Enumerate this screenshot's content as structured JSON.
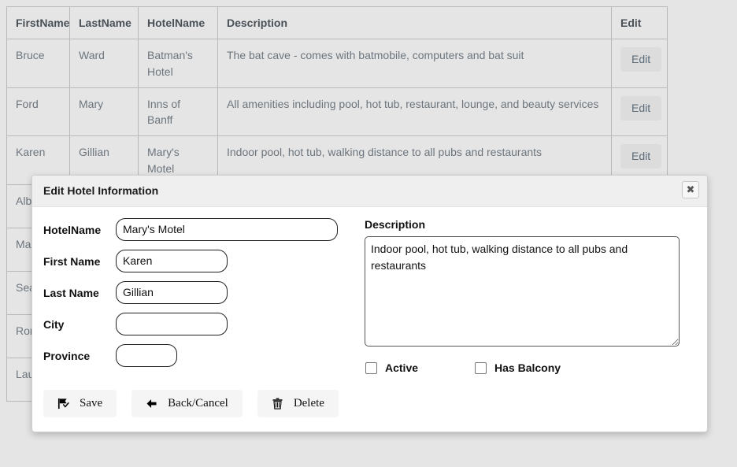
{
  "table": {
    "columns": [
      "FirstName",
      "LastName",
      "HotelName",
      "Description",
      "Edit"
    ],
    "edit_label": "Edit",
    "rows": [
      {
        "first": "Bruce",
        "last": "Ward",
        "hotel": "Batman's Hotel",
        "description": "The bat cave - comes with batmobile, computers and bat suit"
      },
      {
        "first": "Ford",
        "last": "Mary",
        "hotel": "Inns of Banff",
        "description": "All amenities including pool, hot tub, restaurant, lounge, and beauty services"
      },
      {
        "first": "Karen",
        "last": "Gillian",
        "hotel": "Mary's Motel",
        "description": "Indoor pool, hot tub, walking distance to all pubs and restaurants"
      },
      {
        "first": "Albert",
        "last": "",
        "hotel": "",
        "description": ""
      },
      {
        "first": "Max",
        "last": "",
        "hotel": "",
        "description": ""
      },
      {
        "first": "Sean",
        "last": "",
        "hotel": "",
        "description": ""
      },
      {
        "first": "Ron",
        "last": "",
        "hotel": "",
        "description": ""
      },
      {
        "first": "Laura",
        "last": "",
        "hotel": "",
        "description": ""
      }
    ]
  },
  "dialog": {
    "title": "Edit Hotel Information",
    "close_label": "✖",
    "fields": {
      "hotel_name": {
        "label": "HotelName",
        "value": "Mary's Motel",
        "placeholder": ""
      },
      "first_name": {
        "label": "First Name",
        "value": "Karen",
        "placeholder": ""
      },
      "last_name": {
        "label": "Last Name",
        "value": "Gillian",
        "placeholder": ""
      },
      "city": {
        "label": "City",
        "value": "",
        "placeholder": ""
      },
      "province": {
        "label": "Province",
        "value": "",
        "placeholder": ""
      }
    },
    "description": {
      "label": "Description",
      "value": "Indoor pool, hot tub, walking distance to all pubs and restaurants",
      "placeholder": ""
    },
    "checkboxes": [
      {
        "label": "Active",
        "checked": false
      },
      {
        "label": "Has Balcony",
        "checked": false
      }
    ],
    "buttons": [
      {
        "label": "Save",
        "icon": "save-flag-icon"
      },
      {
        "label": "Back/Cancel",
        "icon": "arrow-left-icon"
      },
      {
        "label": "Delete",
        "icon": "trash-icon"
      }
    ]
  },
  "colors": {
    "page_background": "#e5e5e5",
    "table_border": "#b9b9b9",
    "text_muted": "#6c757d",
    "dialog_header": "#efefef",
    "button_face": "#f5f5f5",
    "edit_button": "#dcdcdc"
  }
}
